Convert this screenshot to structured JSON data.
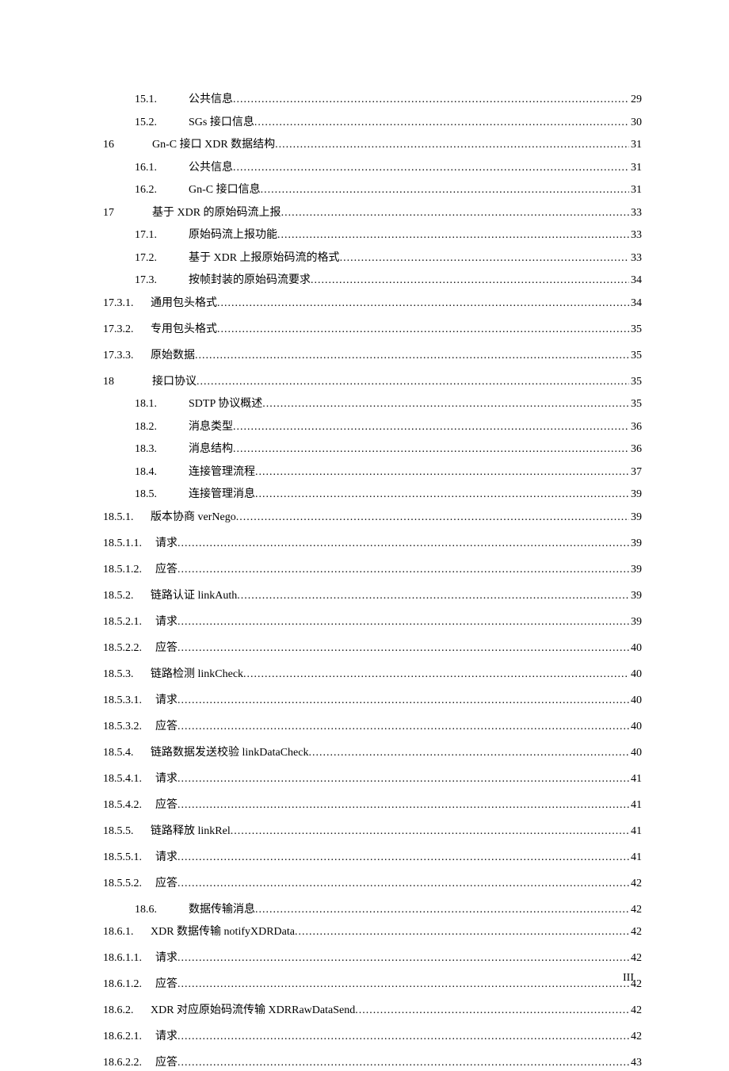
{
  "entries": [
    {
      "num": "15.1.",
      "title": "公共信息",
      "page": "29",
      "indent": 1
    },
    {
      "num": "15.2.",
      "title": "SGs 接口信息",
      "page": "30",
      "indent": 1
    },
    {
      "num": "16",
      "title": "Gn-C 接口 XDR 数据结构",
      "page": "31",
      "indent": 0
    },
    {
      "num": "16.1.",
      "title": "公共信息",
      "page": "31",
      "indent": 1
    },
    {
      "num": "16.2.",
      "title": "Gn-C 接口信息",
      "page": "31",
      "indent": 1
    },
    {
      "num": "17",
      "title": "基于 XDR 的原始码流上报",
      "page": "33",
      "indent": 0
    },
    {
      "num": "17.1.",
      "title": "原始码流上报功能",
      "page": "33",
      "indent": 1
    },
    {
      "num": "17.2.",
      "title": "基于 XDR 上报原始码流的格式",
      "page": "33",
      "indent": 1
    },
    {
      "num": "17.3.",
      "title": "按帧封装的原始码流要求",
      "page": "34",
      "indent": 1
    },
    {
      "num": "17.3.1.",
      "title": "通用包头格式",
      "page": "34",
      "indent": 2,
      "gap": true
    },
    {
      "num": "17.3.2.",
      "title": "专用包头格式",
      "page": "35",
      "indent": 2,
      "gap": true
    },
    {
      "num": "17.3.3.",
      "title": "原始数据",
      "page": "35",
      "indent": 2,
      "gap": true
    },
    {
      "num": "18",
      "title": "接口协议",
      "page": "35",
      "indent": 0
    },
    {
      "num": "18.1.",
      "title": "SDTP 协议概述",
      "page": "35",
      "indent": 1
    },
    {
      "num": "18.2.",
      "title": "消息类型",
      "page": "36",
      "indent": 1
    },
    {
      "num": "18.3.",
      "title": "消息结构",
      "page": "36",
      "indent": 1
    },
    {
      "num": "18.4.",
      "title": "连接管理流程",
      "page": "37",
      "indent": 1
    },
    {
      "num": "18.5.",
      "title": "连接管理消息",
      "page": "39",
      "indent": 1
    },
    {
      "num": "18.5.1.",
      "title": "版本协商 verNego",
      "page": "39",
      "indent": 2,
      "gap": true
    },
    {
      "num": "18.5.1.1.",
      "title": "请求",
      "page": "39",
      "indent": 3,
      "gap": true
    },
    {
      "num": "18.5.1.2.",
      "title": "应答",
      "page": "39",
      "indent": 3,
      "gap": true
    },
    {
      "num": "18.5.2.",
      "title": "链路认证 linkAuth",
      "page": "39",
      "indent": 2,
      "gap": true
    },
    {
      "num": "18.5.2.1.",
      "title": "请求",
      "page": "39",
      "indent": 3,
      "gap": true
    },
    {
      "num": "18.5.2.2.",
      "title": "应答",
      "page": "40",
      "indent": 3,
      "gap": true
    },
    {
      "num": "18.5.3.",
      "title": "链路检测 linkCheck",
      "page": "40",
      "indent": 2,
      "gap": true
    },
    {
      "num": "18.5.3.1.",
      "title": "请求",
      "page": "40",
      "indent": 3,
      "gap": true
    },
    {
      "num": "18.5.3.2.",
      "title": "应答",
      "page": "40",
      "indent": 3,
      "gap": true
    },
    {
      "num": "18.5.4.",
      "title": "链路数据发送校验 linkDataCheck",
      "page": "40",
      "indent": 2,
      "gap": true
    },
    {
      "num": "18.5.4.1.",
      "title": "请求",
      "page": "41",
      "indent": 3,
      "gap": true
    },
    {
      "num": "18.5.4.2.",
      "title": "应答",
      "page": "41",
      "indent": 3,
      "gap": true
    },
    {
      "num": "18.5.5.",
      "title": "链路释放 linkRel",
      "page": "41",
      "indent": 2,
      "gap": true
    },
    {
      "num": "18.5.5.1.",
      "title": "请求",
      "page": "41",
      "indent": 3,
      "gap": true
    },
    {
      "num": "18.5.5.2.",
      "title": "应答",
      "page": "42",
      "indent": 3,
      "gap": true
    },
    {
      "num": "18.6.",
      "title": "数据传输消息",
      "page": "42",
      "indent": 1
    },
    {
      "num": "18.6.1.",
      "title": "XDR 数据传输 notifyXDRData",
      "page": "42",
      "indent": 2,
      "gap": true
    },
    {
      "num": "18.6.1.1.",
      "title": "请求",
      "page": "42",
      "indent": 3,
      "gap": true
    },
    {
      "num": "18.6.1.2.",
      "title": "应答",
      "page": "42",
      "indent": 3,
      "gap": true
    },
    {
      "num": "18.6.2.",
      "title": "XDR 对应原始码流传输 XDRRawDataSend",
      "page": "42",
      "indent": 2,
      "gap": true
    },
    {
      "num": "18.6.2.1.",
      "title": "请求",
      "page": "42",
      "indent": 3,
      "gap": true
    },
    {
      "num": "18.6.2.2.",
      "title": "应答",
      "page": "43",
      "indent": 3,
      "gap": true
    }
  ],
  "page_number": "III"
}
